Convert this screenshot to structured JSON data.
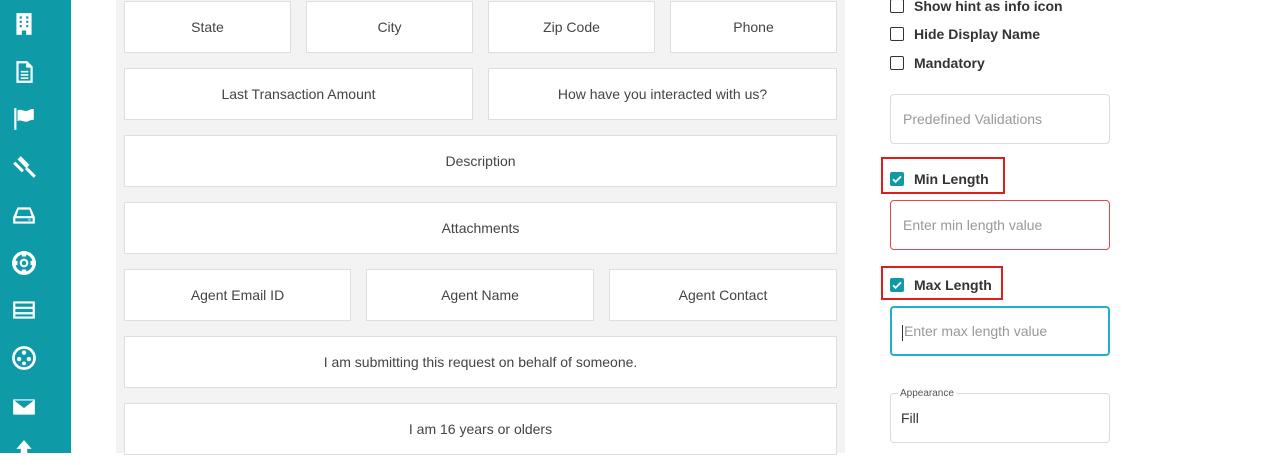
{
  "sidebar": {
    "icons": [
      "building-icon",
      "document-icon",
      "flag-icon",
      "gavel-icon",
      "hard-drive-icon",
      "lifebuoy-icon",
      "list-icon",
      "network-icon",
      "envelope-icon",
      "upload-icon"
    ]
  },
  "form": {
    "fields": {
      "state": "State",
      "city": "City",
      "zip": "Zip Code",
      "phone": "Phone",
      "last_transaction": "Last Transaction Amount",
      "interacted": "How have you interacted with us?",
      "description": "Description",
      "attachments": "Attachments",
      "agent_email": "Agent Email ID",
      "agent_name": "Agent Name",
      "agent_contact": "Agent Contact",
      "behalf": "I am submitting this request on behalf of someone.",
      "age": "I am 16 years or olders"
    }
  },
  "properties": {
    "show_hint": {
      "label": "Show hint as info icon",
      "checked": false
    },
    "hide_display": {
      "label": "Hide Display Name",
      "checked": false
    },
    "mandatory": {
      "label": "Mandatory",
      "checked": false
    },
    "predefined_validations": {
      "placeholder": "Predefined Validations"
    },
    "min_length": {
      "label": "Min Length",
      "checked": true,
      "placeholder": "Enter min length value"
    },
    "max_length": {
      "label": "Max Length",
      "checked": true,
      "placeholder": "Enter max length value"
    },
    "appearance": {
      "label": "Appearance",
      "value": "Fill"
    }
  },
  "colors": {
    "sidebar": "#0e9aa7",
    "highlight": "#e01d1d",
    "error_border": "#e04848",
    "focus_border": "#1eb3c4"
  }
}
